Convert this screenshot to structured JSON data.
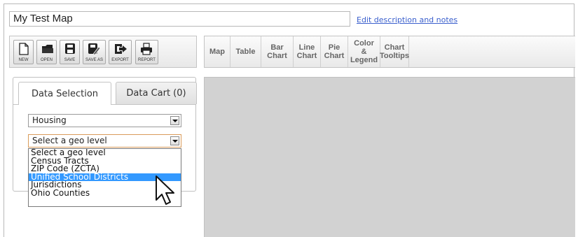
{
  "map": {
    "title_value": "My Test Map",
    "edit_link": "Edit description and notes"
  },
  "toolbar": {
    "buttons": [
      {
        "label": "NEW",
        "icon": "new-file-icon"
      },
      {
        "label": "OPEN",
        "icon": "open-folder-icon"
      },
      {
        "label": "SAVE",
        "icon": "save-disk-icon"
      },
      {
        "label": "SAVE AS",
        "icon": "save-as-icon"
      },
      {
        "label": "EXPORT",
        "icon": "export-icon"
      },
      {
        "label": "REPORT",
        "icon": "printer-icon"
      }
    ]
  },
  "view_tabs": [
    {
      "label": "Map"
    },
    {
      "label": "Table"
    },
    {
      "label": "Bar\nChart"
    },
    {
      "label": "Line\nChart"
    },
    {
      "label": "Pie\nChart"
    },
    {
      "label": "Color\n& Legend"
    },
    {
      "label": "Chart\nTooltips"
    }
  ],
  "panel": {
    "tabs": [
      {
        "label": "Data Selection",
        "active": true
      },
      {
        "label": "Data Cart (0)",
        "active": false
      }
    ],
    "topic_select": "Housing",
    "geo_select": "Select a geo level",
    "geo_options": [
      "Select a geo level",
      "Census Tracts",
      "ZIP Code (ZCTA)",
      "Unified School Districts",
      "Jurisdictions",
      "Ohio Counties"
    ],
    "highlighted_option": "Unified School Districts"
  },
  "colors": {
    "link": "#3a5fcd",
    "selection_highlight": "#3399ff",
    "canvas": "#d2d2d2"
  }
}
